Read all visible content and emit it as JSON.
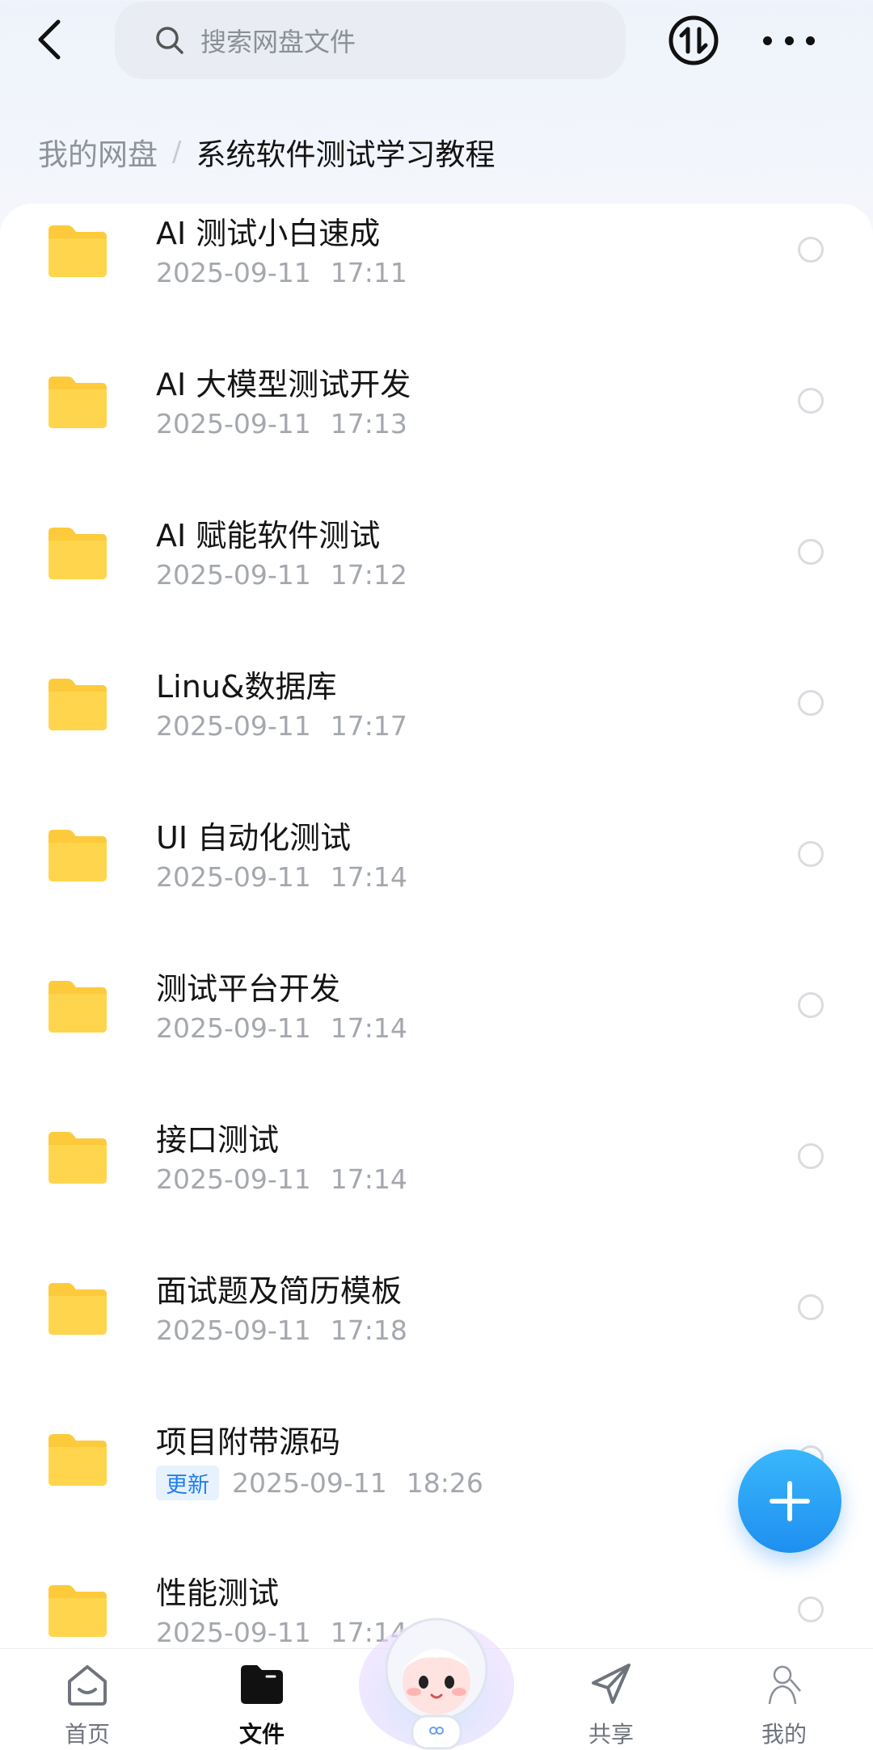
{
  "header": {
    "search_placeholder": "搜索网盘文件"
  },
  "breadcrumb": {
    "root": "我的网盘",
    "separator": "/",
    "current": "系统软件测试学习教程"
  },
  "files": [
    {
      "name": "AI 测试小白速成",
      "date": "2025-09-11",
      "time": "17:11"
    },
    {
      "name": "AI 大模型测试开发",
      "date": "2025-09-11",
      "time": "17:13"
    },
    {
      "name": "AI 赋能软件测试",
      "date": "2025-09-11",
      "time": "17:12"
    },
    {
      "name": "Linu&数据库",
      "date": "2025-09-11",
      "time": "17:17"
    },
    {
      "name": "UI 自动化测试",
      "date": "2025-09-11",
      "time": "17:14"
    },
    {
      "name": "测试平台开发",
      "date": "2025-09-11",
      "time": "17:14"
    },
    {
      "name": "接口测试",
      "date": "2025-09-11",
      "time": "17:14"
    },
    {
      "name": "面试题及简历模板",
      "date": "2025-09-11",
      "time": "17:18"
    },
    {
      "name": "项目附带源码",
      "badge": "更新",
      "date": "2025-09-11",
      "time": "18:26"
    },
    {
      "name": "性能测试",
      "date": "2025-09-11",
      "time": "17:14"
    }
  ],
  "nav": {
    "home": "首页",
    "files": "文件",
    "share": "共享",
    "mine": "我的"
  },
  "colors": {
    "accent": "#1f8ff0",
    "folder": "#fcca3b",
    "update_badge": "#1d7ff0"
  },
  "icons": {
    "back": "chevron-left-icon",
    "search": "search-icon",
    "sync": "transfer-icon",
    "more": "more-icon",
    "folder": "folder-icon",
    "fab": "plus-icon"
  }
}
